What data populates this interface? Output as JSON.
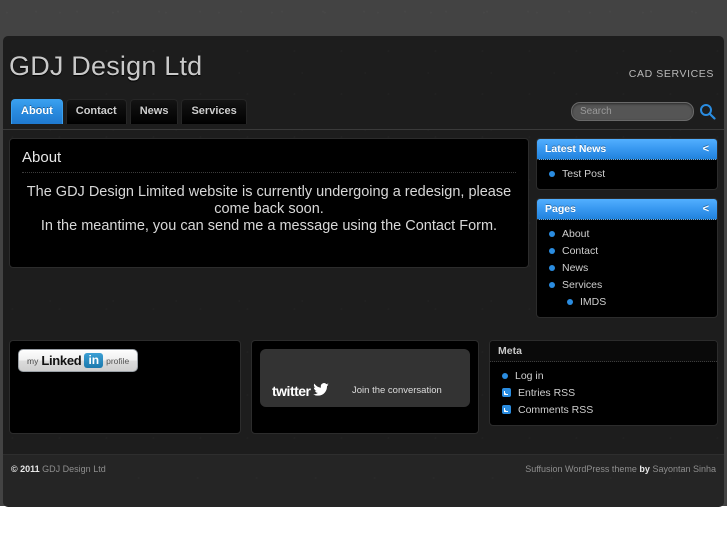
{
  "header": {
    "site_title": "GDJ Design Ltd",
    "tagline": "CAD SERVICES"
  },
  "nav": {
    "items": [
      {
        "label": "About",
        "active": true
      },
      {
        "label": "Contact",
        "active": false
      },
      {
        "label": "News",
        "active": false
      },
      {
        "label": "Services",
        "active": false
      }
    ]
  },
  "search": {
    "value": "",
    "placeholder": "Search",
    "icon": "search-icon",
    "icon_color": "#2a8ce0"
  },
  "content": {
    "post_title": "About",
    "post_body": "The GDJ Design Limited website is currently undergoing a redesign, please come back soon.\nIn the meantime, you can send me a message using the Contact Form."
  },
  "sidebar": {
    "widgets": [
      {
        "title": "Latest News",
        "collapse_icon": "<",
        "style": "blue",
        "items": [
          {
            "label": "Test Post"
          }
        ]
      },
      {
        "title": "Pages",
        "collapse_icon": "<",
        "style": "blue",
        "items": [
          {
            "label": "About"
          },
          {
            "label": "Contact"
          },
          {
            "label": "News"
          },
          {
            "label": "Services",
            "children": [
              {
                "label": "IMDS"
              }
            ]
          }
        ]
      }
    ]
  },
  "bottom": {
    "linkedin": {
      "my": "my",
      "linked": "Linked",
      "in": "in",
      "profile": "profile"
    },
    "twitter": {
      "logo_text": "twitter",
      "tagline": "Join the conversation"
    },
    "meta": {
      "title": "Meta",
      "items": [
        {
          "label": "Log in",
          "icon": "bullet-icon"
        },
        {
          "label": "Entries RSS",
          "icon": "rss-icon"
        },
        {
          "label": "Comments RSS",
          "icon": "rss-icon"
        }
      ]
    }
  },
  "footer": {
    "copyright_strong": "© 2011",
    "copyright_rest": " GDJ Design Ltd",
    "credit_pre": "Suffusion WordPress theme ",
    "credit_by": "by",
    "credit_post": " Sayontan Sinha"
  },
  "theme": {
    "accent": "#2a8ce0",
    "page_bg": "#434343",
    "wrapper_bg": "#1d1d1d",
    "box_bg": "#000000"
  }
}
